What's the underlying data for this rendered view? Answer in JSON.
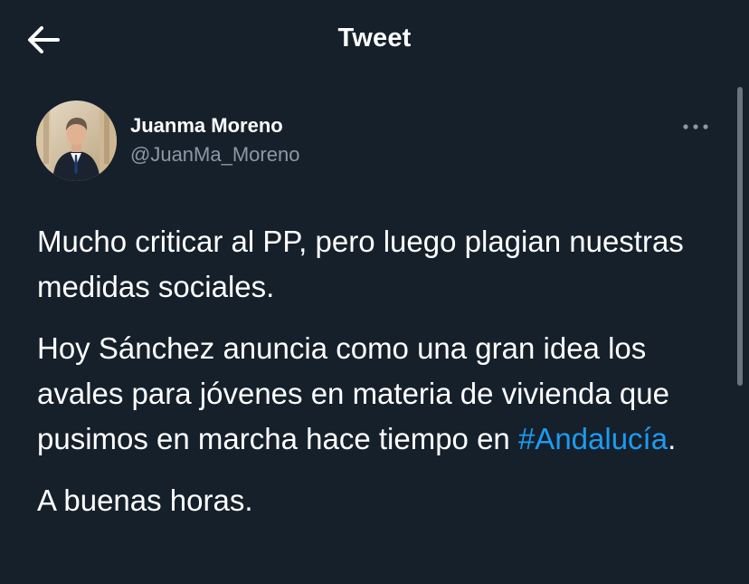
{
  "header": {
    "title": "Tweet",
    "back_icon": "arrow-left-icon"
  },
  "tweet": {
    "author": {
      "name": "Juanma Moreno",
      "handle": "@JuanMa_Moreno",
      "avatar_icon": "avatar-photo"
    },
    "more_icon": "more-horizontal-icon",
    "paragraphs": [
      {
        "text": "Mucho criticar al PP, pero luego plagian nuestras medidas sociales."
      },
      {
        "text_before": "Hoy Sánchez anuncia como una gran idea los avales para jóvenes en materia de vivienda que pusimos en marcha hace tiempo en ",
        "hashtag": "#Andalucía",
        "text_after": "."
      },
      {
        "text": "A buenas horas."
      }
    ]
  },
  "colors": {
    "background": "#15202b",
    "text": "#ffffff",
    "secondary_text": "#8b98a5",
    "link": "#1d9bf0"
  }
}
